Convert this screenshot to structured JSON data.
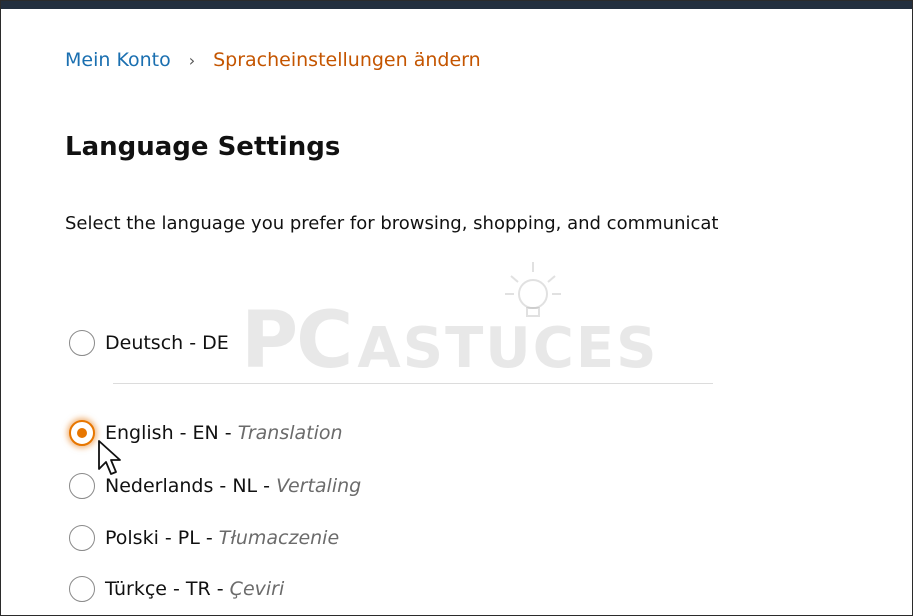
{
  "breadcrumb": {
    "parent": "Mein Konto",
    "separator": "›",
    "current": "Spracheinstellungen ändern"
  },
  "page": {
    "title": "Language Settings",
    "description": "Select the language you prefer for browsing, shopping, and communicat"
  },
  "watermark": {
    "part1": "PC",
    "part2": "ASTUCES"
  },
  "languages": [
    {
      "name": "Deutsch - DE",
      "translation": "",
      "selected": false
    },
    {
      "name": "English - EN",
      "translation": "Translation",
      "selected": true
    },
    {
      "name": "Nederlands - NL",
      "translation": "Vertaling",
      "selected": false
    },
    {
      "name": "Polski - PL",
      "translation": "Tłumaczenie",
      "selected": false
    },
    {
      "name": "Türkçe - TR",
      "translation": "Çeviri",
      "selected": false
    }
  ],
  "colors": {
    "link": "#1a6fb0",
    "current_crumb": "#c45500",
    "accent": "#e77600",
    "topbar": "#232f3e"
  },
  "icons": {
    "cursor": "mouse-pointer-icon",
    "watermark_bulb": "lightbulb-icon"
  }
}
